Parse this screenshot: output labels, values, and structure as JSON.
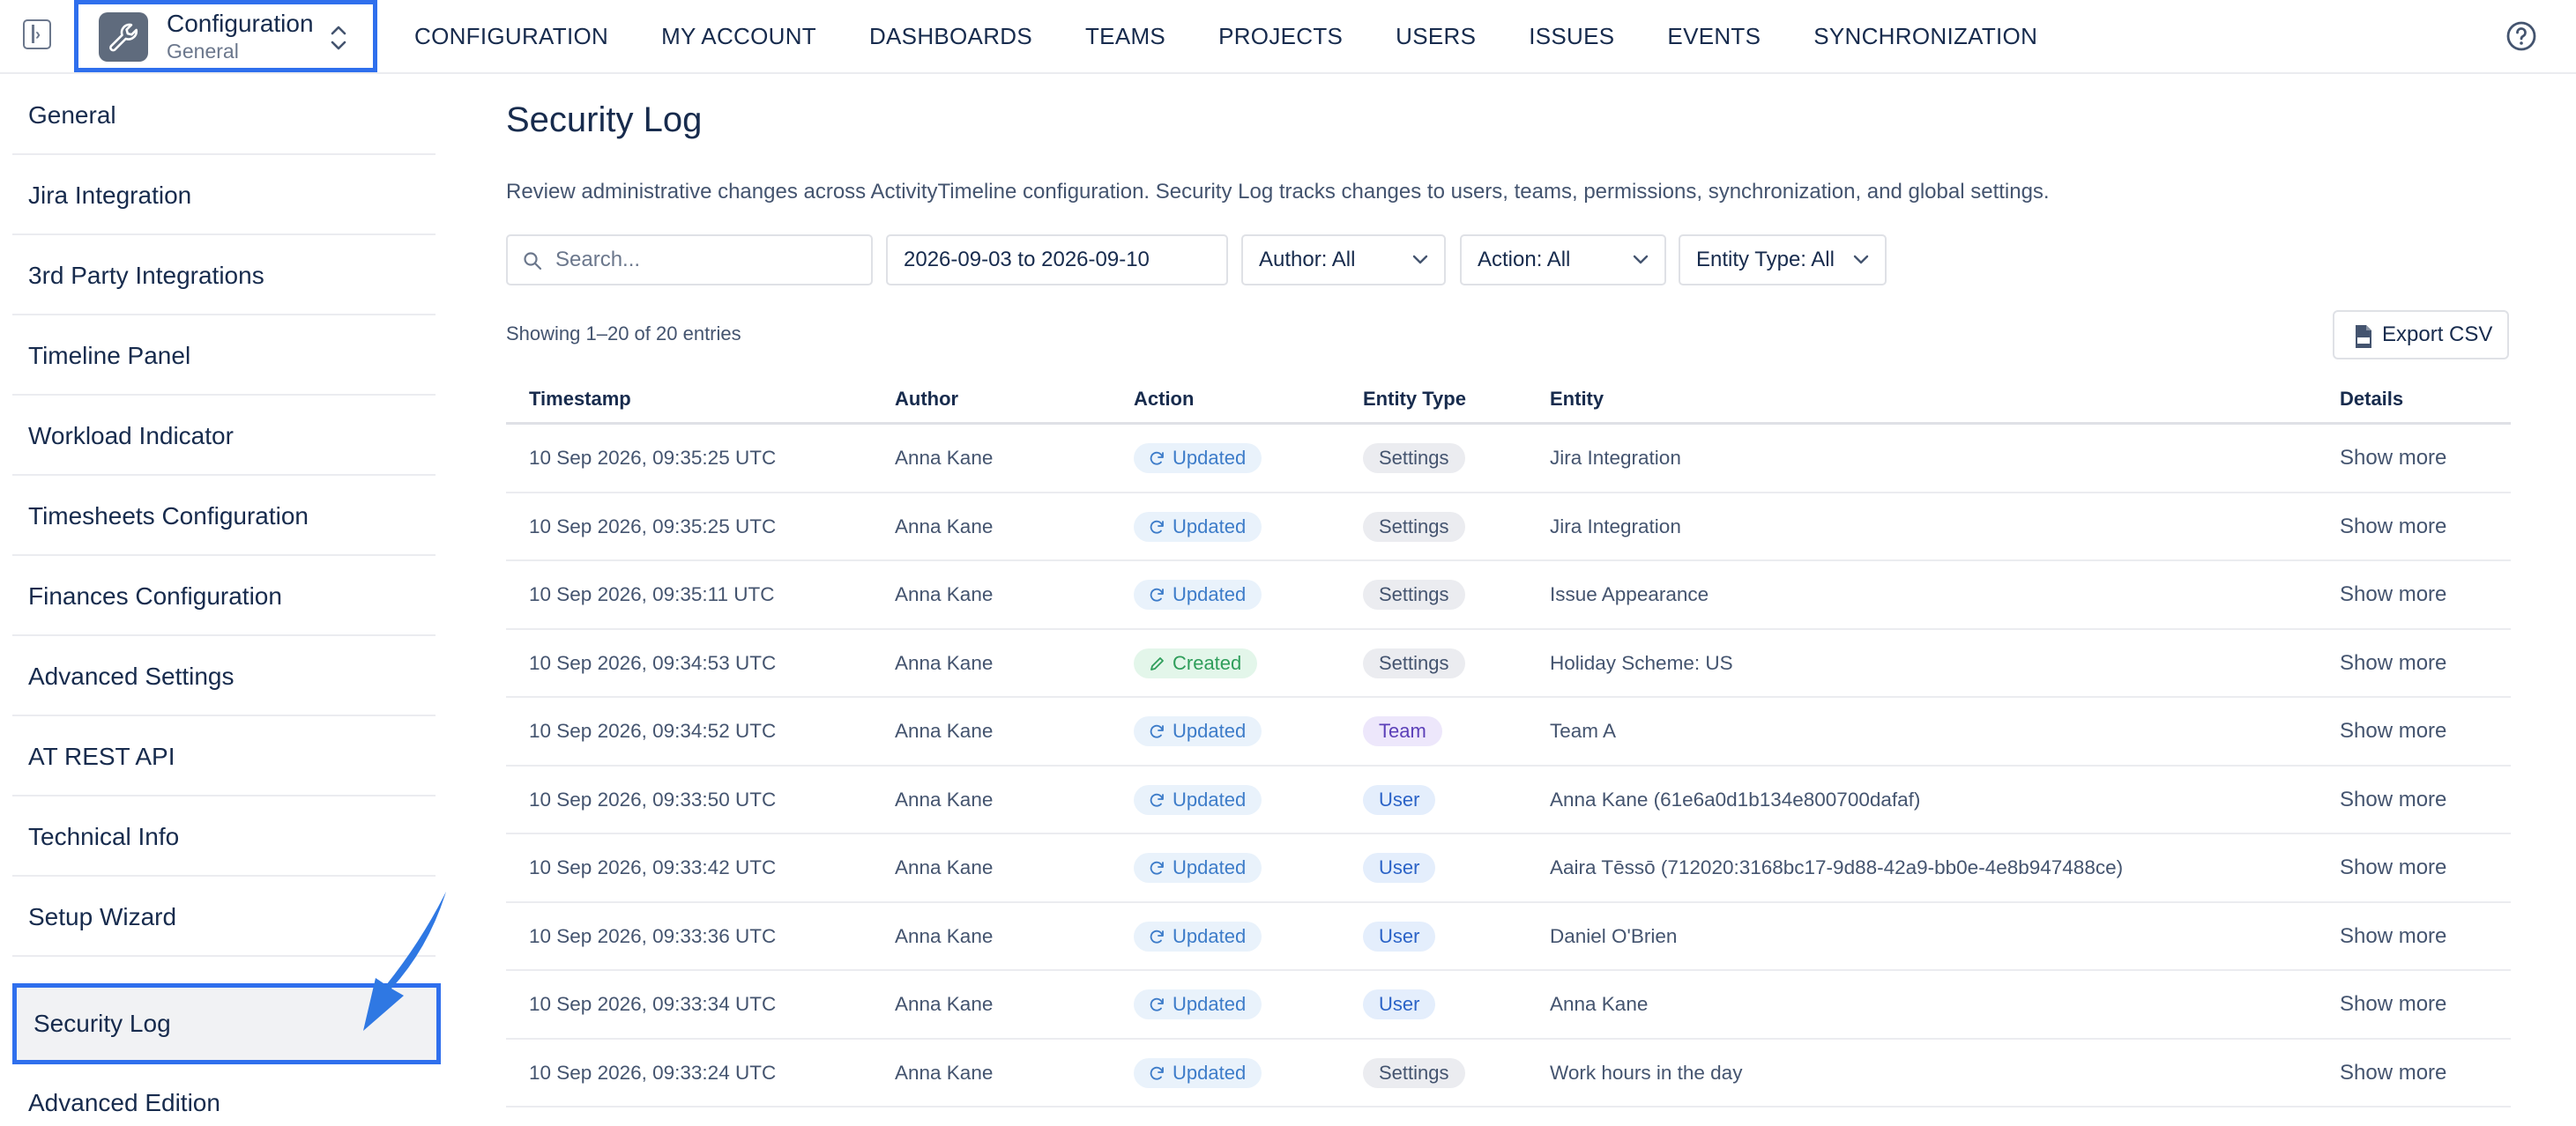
{
  "topbar": {
    "app_title": "Configuration",
    "app_subtitle": "General",
    "nav": [
      "CONFIGURATION",
      "MY ACCOUNT",
      "DASHBOARDS",
      "TEAMS",
      "PROJECTS",
      "USERS",
      "ISSUES",
      "EVENTS",
      "SYNCHRONIZATION"
    ],
    "icons": {
      "collapse": "collapse-sidebar-icon",
      "app": "wrench-icon",
      "switch": "chevron-updown-icon",
      "help": "help-circle-icon"
    }
  },
  "sidebar": {
    "items": [
      {
        "label": "General"
      },
      {
        "label": "Jira Integration"
      },
      {
        "label": "3rd Party Integrations"
      },
      {
        "label": "Timeline Panel"
      },
      {
        "label": "Workload Indicator"
      },
      {
        "label": "Timesheets Configuration"
      },
      {
        "label": "Finances Configuration"
      },
      {
        "label": "Advanced Settings"
      },
      {
        "label": "AT REST API"
      },
      {
        "label": "Technical Info"
      },
      {
        "label": "Setup Wizard"
      },
      {
        "label": "Security Log"
      },
      {
        "label": "Advanced Edition"
      }
    ],
    "active": "Security Log"
  },
  "main": {
    "title": "Security Log",
    "description": "Review administrative changes across ActivityTimeline configuration. Security Log tracks changes to users, teams, permissions, synchronization, and global settings.",
    "filters": {
      "search_placeholder": "Search...",
      "date_range": "2026-09-03 to 2026-09-10",
      "author": "Author: All",
      "action": "Action: All",
      "entity_type": "Entity Type: All"
    },
    "showing": "Showing 1–20 of 20 entries",
    "export_label": "Export CSV",
    "columns": {
      "timestamp": "Timestamp",
      "author": "Author",
      "action": "Action",
      "entity_type": "Entity Type",
      "entity": "Entity",
      "details": "Details"
    },
    "rows": [
      {
        "timestamp": "10 Sep 2026, 09:35:25 UTC",
        "author": "Anna Kane",
        "action": "Updated",
        "entity_type": "Settings",
        "entity": "Jira Integration",
        "details": "Show more"
      },
      {
        "timestamp": "10 Sep 2026, 09:35:25 UTC",
        "author": "Anna Kane",
        "action": "Updated",
        "entity_type": "Settings",
        "entity": "Jira Integration",
        "details": "Show more"
      },
      {
        "timestamp": "10 Sep 2026, 09:35:11 UTC",
        "author": "Anna Kane",
        "action": "Updated",
        "entity_type": "Settings",
        "entity": "Issue Appearance",
        "details": "Show more"
      },
      {
        "timestamp": "10 Sep 2026, 09:34:53 UTC",
        "author": "Anna Kane",
        "action": "Created",
        "entity_type": "Settings",
        "entity": "Holiday Scheme: US",
        "details": "Show more"
      },
      {
        "timestamp": "10 Sep 2026, 09:34:52 UTC",
        "author": "Anna Kane",
        "action": "Updated",
        "entity_type": "Team",
        "entity": "Team A",
        "details": "Show more"
      },
      {
        "timestamp": "10 Sep 2026, 09:33:50 UTC",
        "author": "Anna Kane",
        "action": "Updated",
        "entity_type": "User",
        "entity": "Anna Kane (61e6a0d1b134e800700dafaf)",
        "details": "Show more"
      },
      {
        "timestamp": "10 Sep 2026, 09:33:42 UTC",
        "author": "Anna Kane",
        "action": "Updated",
        "entity_type": "User",
        "entity": "Aaira Tēssō (712020:3168bc17-9d88-42a9-bb0e-4e8b947488ce)",
        "details": "Show more"
      },
      {
        "timestamp": "10 Sep 2026, 09:33:36 UTC",
        "author": "Anna Kane",
        "action": "Updated",
        "entity_type": "User",
        "entity": "Daniel O'Brien",
        "details": "Show more"
      },
      {
        "timestamp": "10 Sep 2026, 09:33:34 UTC",
        "author": "Anna Kane",
        "action": "Updated",
        "entity_type": "User",
        "entity": "Anna Kane",
        "details": "Show more"
      },
      {
        "timestamp": "10 Sep 2026, 09:33:24 UTC",
        "author": "Anna Kane",
        "action": "Updated",
        "entity_type": "Settings",
        "entity": "Work hours in the day",
        "details": "Show more"
      }
    ]
  },
  "colors": {
    "highlight_border": "#2f6fed",
    "updated_badge": "#3d7cc9",
    "created_badge": "#2f9e5b",
    "team_badge": "#5b3fb8",
    "user_badge": "#2b63c7"
  }
}
